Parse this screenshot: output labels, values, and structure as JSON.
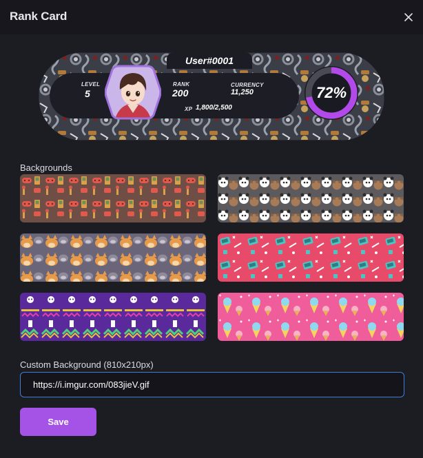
{
  "dialog": {
    "title": "Rank Card",
    "close_icon": "close-icon"
  },
  "rank_card": {
    "username": "User#0001",
    "level_label": "LEVEL",
    "level_value": "5",
    "rank_label": "RANK",
    "rank_value": "200",
    "currency_label": "CURRENCY",
    "currency_value": "11,250",
    "xp_label": "XP",
    "xp_value": "1,800/2,500",
    "progress_percent_text": "72%",
    "progress_fraction": 0.72,
    "colors": {
      "progress": "#b14ae8",
      "progress_alt": "#e23fa8",
      "track": "#4a4a55"
    }
  },
  "backgrounds": {
    "label": "Backgrounds",
    "options": [
      {
        "name": "retro-gaming-pattern",
        "base": "#6f4f45",
        "accent": "#e2584c",
        "accent2": "#d9a14a"
      },
      {
        "name": "panda-bears-pattern",
        "base": "#5c5a5c",
        "accent": "#ffffff",
        "accent2": "#a77b58"
      },
      {
        "name": "shiba-dogs-pattern",
        "base": "#6a6578",
        "accent": "#e79b4a",
        "accent2": "#f3d8ae"
      },
      {
        "name": "arcade-pink-pattern",
        "base": "#e84a6a",
        "accent": "#4fc3c4",
        "accent2": "#ffffff"
      },
      {
        "name": "purple-skulls-pattern",
        "base": "#5a2a9c",
        "accent": "#ffffff",
        "accent2": "#e8c23a"
      },
      {
        "name": "ice-cream-pattern",
        "base": "#ef5d9a",
        "accent": "#f4d35e",
        "accent2": "#8fd8f0"
      }
    ]
  },
  "custom_background": {
    "label": "Custom Background (810x210px)",
    "value": "https://i.imgur.com/083jieV.gif"
  },
  "save_button": {
    "label": "Save",
    "color": "#a553e6"
  }
}
